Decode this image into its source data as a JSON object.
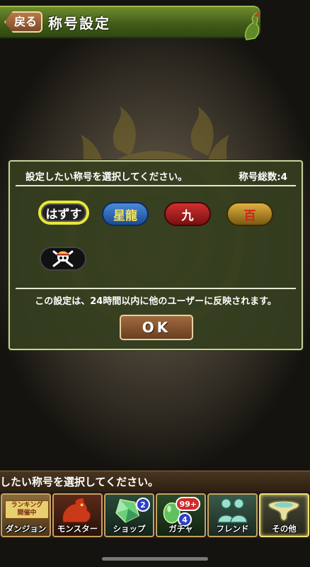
{
  "header": {
    "back_label": "戻る",
    "title": "称号設定"
  },
  "dialog": {
    "prompt": "設定したい称号を選択してください。",
    "total_label": "称号総数:4",
    "titles": [
      {
        "label": "はずす",
        "selected": true
      },
      {
        "label": "星龍",
        "selected": false
      },
      {
        "label": "九",
        "selected": false
      },
      {
        "label": "百",
        "selected": false
      },
      {
        "label": "skull-crossbones-icon",
        "selected": false
      }
    ],
    "notice": "この設定は、24時間以内に他のユーザーに反映されます。",
    "ok_label": "OK"
  },
  "ticker": {
    "text": "したい称号を選択してください。"
  },
  "tabs": [
    {
      "label": "ダンジョン",
      "banner": "ランキング\n開催中"
    },
    {
      "label": "モンスター"
    },
    {
      "label": "ショップ",
      "badge": "2"
    },
    {
      "label": "ガチャ",
      "badge_top": "99+",
      "badge": "4"
    },
    {
      "label": "フレンド"
    },
    {
      "label": "その他",
      "active": true
    }
  ],
  "colors": {
    "header_green": "#4f6a1e",
    "dialog_bg": "#343e1e",
    "selected_outline": "#e8e838"
  }
}
